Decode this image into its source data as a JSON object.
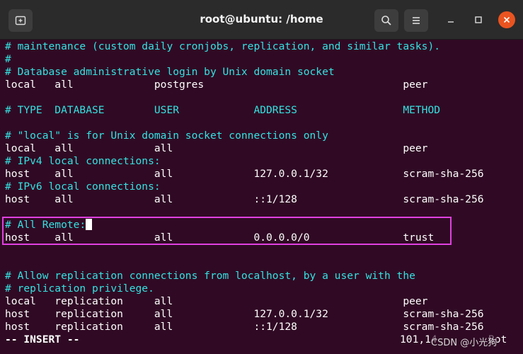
{
  "window": {
    "title": "root@ubuntu: /home",
    "new_tab_icon": "new-tab-icon",
    "search_icon": "search-icon",
    "menu_icon": "hamburger-menu-icon",
    "minimize_icon": "minimize-icon",
    "maximize_icon": "maximize-icon",
    "close_icon": "close-icon",
    "close_color": "#e95420"
  },
  "terminal": {
    "background": "#300a24",
    "comment_color": "#34e2e2",
    "text_color": "#ffffff",
    "lines": [
      {
        "text": "# maintenance (custom daily cronjobs, replication, and similar tasks).",
        "kind": "comment"
      },
      {
        "text": "#",
        "kind": "comment"
      },
      {
        "text": "# Database administrative login by Unix domain socket",
        "kind": "comment"
      },
      {
        "text": "local   all             postgres                                peer",
        "kind": "normal"
      },
      {
        "text": "",
        "kind": "normal"
      },
      {
        "text": "# TYPE  DATABASE        USER            ADDRESS                 METHOD",
        "kind": "comment"
      },
      {
        "text": "",
        "kind": "normal"
      },
      {
        "text": "# \"local\" is for Unix domain socket connections only",
        "kind": "comment"
      },
      {
        "text": "local   all             all                                     peer",
        "kind": "normal"
      },
      {
        "text": "# IPv4 local connections:",
        "kind": "comment"
      },
      {
        "text": "host    all             all             127.0.0.1/32            scram-sha-256",
        "kind": "normal"
      },
      {
        "text": "# IPv6 local connections:",
        "kind": "comment"
      },
      {
        "text": "host    all             all             ::1/128                 scram-sha-256",
        "kind": "normal"
      },
      {
        "text": "",
        "kind": "normal"
      },
      {
        "text": "# All Remote:",
        "kind": "comment",
        "cursor": true
      },
      {
        "text": "host    all             all             0.0.0.0/0               trust",
        "kind": "normal"
      },
      {
        "text": "",
        "kind": "normal"
      },
      {
        "text": "",
        "kind": "normal"
      },
      {
        "text": "# Allow replication connections from localhost, by a user with the",
        "kind": "comment"
      },
      {
        "text": "# replication privilege.",
        "kind": "comment"
      },
      {
        "text": "local   replication     all                                     peer",
        "kind": "normal"
      },
      {
        "text": "host    replication     all             127.0.0.1/32            scram-sha-256",
        "kind": "normal"
      },
      {
        "text": "host    replication     all             ::1/128                 scram-sha-256",
        "kind": "normal"
      }
    ],
    "status_mode": "-- INSERT --",
    "cursor_position": "101,14",
    "scroll_position": "Bot"
  },
  "highlight_color": "#e040e0",
  "watermark": "CSDN @小光狗"
}
